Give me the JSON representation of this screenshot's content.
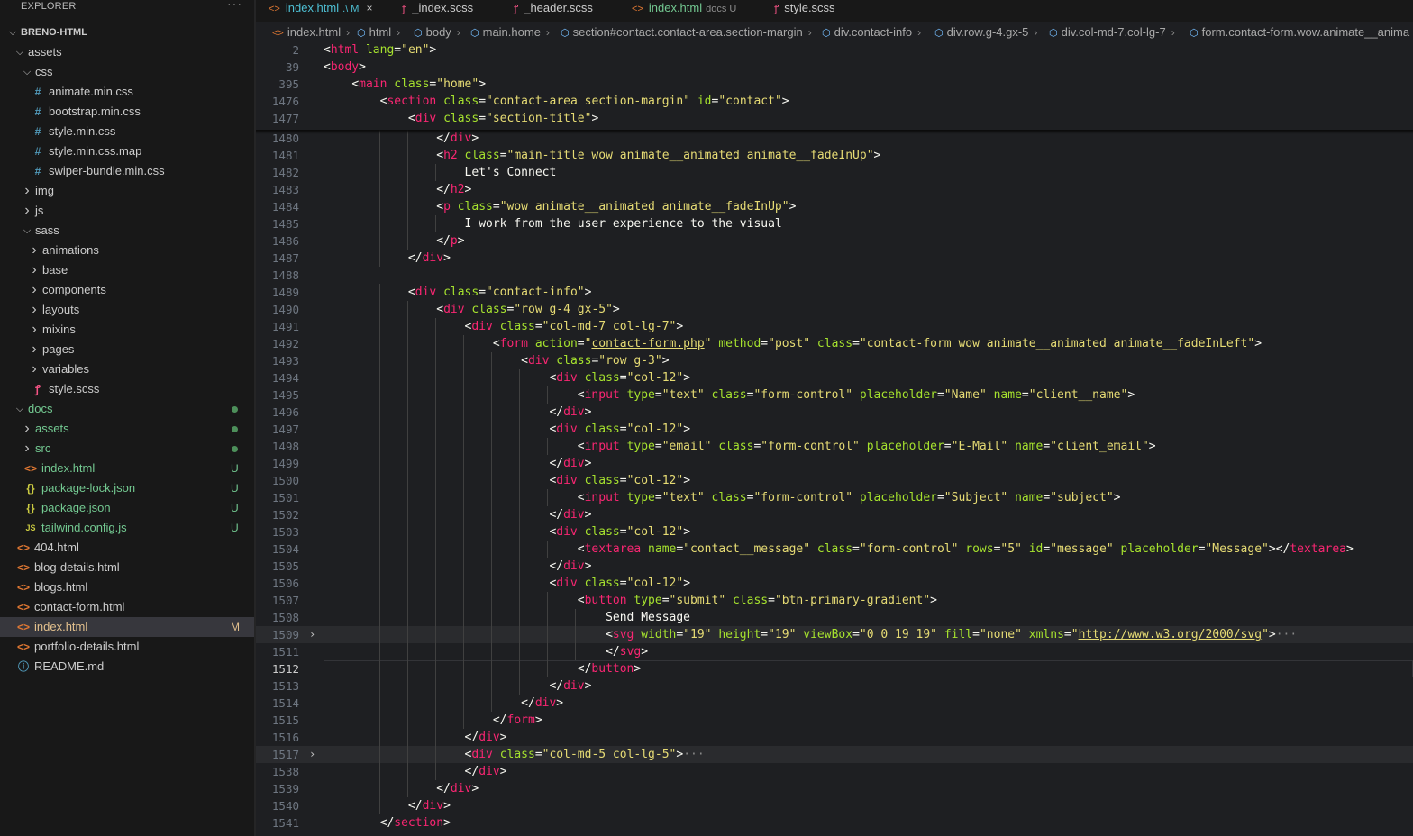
{
  "explorer": {
    "title": "EXPLORER",
    "more": "···"
  },
  "tree": [
    {
      "label": "BRENO-HTML",
      "kind": "root",
      "chev": "v",
      "depth": 0
    },
    {
      "label": "assets",
      "kind": "folder",
      "chev": "v",
      "depth": 1
    },
    {
      "label": "css",
      "kind": "folder",
      "chev": "v",
      "depth": 2
    },
    {
      "label": "animate.min.css",
      "kind": "css",
      "icon": "#",
      "depth": 3
    },
    {
      "label": "bootstrap.min.css",
      "kind": "css",
      "icon": "#",
      "depth": 3
    },
    {
      "label": "style.min.css",
      "kind": "css",
      "icon": "#",
      "depth": 3
    },
    {
      "label": "style.min.css.map",
      "kind": "css",
      "icon": "#",
      "depth": 3
    },
    {
      "label": "swiper-bundle.min.css",
      "kind": "css",
      "icon": "#",
      "depth": 3
    },
    {
      "label": "img",
      "kind": "folder",
      "chev": ">",
      "depth": 2
    },
    {
      "label": "js",
      "kind": "folder",
      "chev": ">",
      "depth": 2
    },
    {
      "label": "sass",
      "kind": "folder",
      "chev": "v",
      "depth": 2
    },
    {
      "label": "animations",
      "kind": "folder",
      "chev": ">",
      "depth": 3
    },
    {
      "label": "base",
      "kind": "folder",
      "chev": ">",
      "depth": 3
    },
    {
      "label": "components",
      "kind": "folder",
      "chev": ">",
      "depth": 3
    },
    {
      "label": "layouts",
      "kind": "folder",
      "chev": ">",
      "depth": 3
    },
    {
      "label": "mixins",
      "kind": "folder",
      "chev": ">",
      "depth": 3
    },
    {
      "label": "pages",
      "kind": "folder",
      "chev": ">",
      "depth": 3
    },
    {
      "label": "variables",
      "kind": "folder",
      "chev": ">",
      "depth": 3
    },
    {
      "label": "style.scss",
      "kind": "scss",
      "icon": "ꝭ",
      "depth": 3
    },
    {
      "label": "docs",
      "kind": "folder",
      "chev": "v",
      "depth": 1,
      "status": "green",
      "dot": true
    },
    {
      "label": "assets",
      "kind": "folder",
      "chev": ">",
      "depth": 2,
      "status": "green",
      "dot": true
    },
    {
      "label": "src",
      "kind": "folder",
      "chev": ">",
      "depth": 2,
      "status": "green",
      "dot": true
    },
    {
      "label": "index.html",
      "kind": "html",
      "icon": "<>",
      "depth": 2,
      "status": "green",
      "badge": "U"
    },
    {
      "label": "package-lock.json",
      "kind": "json",
      "icon": "{}",
      "depth": 2,
      "status": "green",
      "badge": "U"
    },
    {
      "label": "package.json",
      "kind": "json",
      "icon": "{}",
      "depth": 2,
      "status": "green",
      "badge": "U"
    },
    {
      "label": "tailwind.config.js",
      "kind": "js",
      "icon": "JS",
      "depth": 2,
      "status": "green",
      "badge": "U"
    },
    {
      "label": "404.html",
      "kind": "html",
      "icon": "<>",
      "depth": 1
    },
    {
      "label": "blog-details.html",
      "kind": "html",
      "icon": "<>",
      "depth": 1
    },
    {
      "label": "blogs.html",
      "kind": "html",
      "icon": "<>",
      "depth": 1
    },
    {
      "label": "contact-form.html",
      "kind": "html",
      "icon": "<>",
      "depth": 1
    },
    {
      "label": "index.html",
      "kind": "html",
      "icon": "<>",
      "depth": 1,
      "status": "modified",
      "badge": "M",
      "selected": true
    },
    {
      "label": "portfolio-details.html",
      "kind": "html",
      "icon": "<>",
      "depth": 1
    },
    {
      "label": "README.md",
      "kind": "info",
      "icon": "ⓘ",
      "depth": 1
    }
  ],
  "tabs": [
    {
      "label": "index.html",
      "icon": "<>",
      "kind": "html",
      "suffix": ".\\ M",
      "active": true,
      "close": "×"
    },
    {
      "label": "_index.scss",
      "icon": "ꝭ",
      "kind": "scss"
    },
    {
      "label": "_header.scss",
      "icon": "ꝭ",
      "kind": "scss"
    },
    {
      "label": "index.html",
      "icon": "<>",
      "kind": "html",
      "suffix": "docs U",
      "green": true
    },
    {
      "label": "style.scss",
      "icon": "ꝭ",
      "kind": "scss"
    }
  ],
  "breadcrumb": [
    {
      "label": "index.html",
      "icon": "<>"
    },
    {
      "label": "html",
      "icon": "⬡"
    },
    {
      "label": "body",
      "icon": "⬡"
    },
    {
      "label": "main.home",
      "icon": "⬡"
    },
    {
      "label": "section#contact.contact-area.section-margin",
      "icon": "⬡"
    },
    {
      "label": "div.contact-info",
      "icon": "⬡"
    },
    {
      "label": "div.row.g-4.gx-5",
      "icon": "⬡"
    },
    {
      "label": "div.col-md-7.col-lg-7",
      "icon": "⬡"
    },
    {
      "label": "form.contact-form.wow.animate__anima",
      "icon": "⬡"
    }
  ],
  "sticky_lines": [
    {
      "n": "2",
      "text": "<html lang=\"en\">"
    },
    {
      "n": "39",
      "text": "<body>"
    },
    {
      "n": "395",
      "text": "    <main class=\"home\">"
    },
    {
      "n": "1476",
      "text": "        <section class=\"contact-area section-margin\" id=\"contact\">"
    },
    {
      "n": "1477",
      "text": "            <div class=\"section-title\">"
    }
  ],
  "code_lines": [
    {
      "n": "1480",
      "text": "                </div>"
    },
    {
      "n": "1481",
      "text": "                <h2 class=\"main-title wow animate__animated animate__fadeInUp\">"
    },
    {
      "n": "1482",
      "text": "                    Let's Connect"
    },
    {
      "n": "1483",
      "text": "                </h2>"
    },
    {
      "n": "1484",
      "text": "                <p class=\"wow animate__animated animate__fadeInUp\">"
    },
    {
      "n": "1485",
      "text": "                    I work from the user experience to the visual"
    },
    {
      "n": "1486",
      "text": "                </p>"
    },
    {
      "n": "1487",
      "text": "            </div>"
    },
    {
      "n": "1488",
      "text": ""
    },
    {
      "n": "1489",
      "text": "            <div class=\"contact-info\">"
    },
    {
      "n": "1490",
      "text": "                <div class=\"row g-4 gx-5\">"
    },
    {
      "n": "1491",
      "text": "                    <div class=\"col-md-7 col-lg-7\">"
    },
    {
      "n": "1492",
      "text": "                        <form action=\"contact-form.php\" method=\"post\" class=\"contact-form wow animate__animated animate__fadeInLeft\">"
    },
    {
      "n": "1493",
      "text": "                            <div class=\"row g-3\">"
    },
    {
      "n": "1494",
      "text": "                                <div class=\"col-12\">"
    },
    {
      "n": "1495",
      "text": "                                    <input type=\"text\" class=\"form-control\" placeholder=\"Name\" name=\"client__name\">"
    },
    {
      "n": "1496",
      "text": "                                </div>"
    },
    {
      "n": "1497",
      "text": "                                <div class=\"col-12\">"
    },
    {
      "n": "1498",
      "text": "                                    <input type=\"email\" class=\"form-control\" placeholder=\"E-Mail\" name=\"client_email\">"
    },
    {
      "n": "1499",
      "text": "                                </div>"
    },
    {
      "n": "1500",
      "text": "                                <div class=\"col-12\">"
    },
    {
      "n": "1501",
      "text": "                                    <input type=\"text\" class=\"form-control\" placeholder=\"Subject\" name=\"subject\">"
    },
    {
      "n": "1502",
      "text": "                                </div>"
    },
    {
      "n": "1503",
      "text": "                                <div class=\"col-12\">"
    },
    {
      "n": "1504",
      "text": "                                    <textarea name=\"contact__message\" class=\"form-control\" rows=\"5\" id=\"message\" placeholder=\"Message\"></textarea>"
    },
    {
      "n": "1505",
      "text": "                                </div>"
    },
    {
      "n": "1506",
      "text": "                                <div class=\"col-12\">"
    },
    {
      "n": "1507",
      "text": "                                    <button type=\"submit\" class=\"btn-primary-gradient\">"
    },
    {
      "n": "1508",
      "text": "                                        Send Message"
    },
    {
      "n": "1509",
      "text": "                                        <svg width=\"19\" height=\"19\" viewBox=\"0 0 19 19\" fill=\"none\" xmlns=\"http://www.w3.org/2000/svg\">···",
      "fold": true,
      "hl": true
    },
    {
      "n": "1511",
      "text": "                                        </svg>"
    },
    {
      "n": "1512",
      "text": "                                    </button>",
      "current": true
    },
    {
      "n": "1513",
      "text": "                                </div>"
    },
    {
      "n": "1514",
      "text": "                            </div>"
    },
    {
      "n": "1515",
      "text": "                        </form>"
    },
    {
      "n": "1516",
      "text": "                    </div>"
    },
    {
      "n": "1517",
      "text": "                    <div class=\"col-md-5 col-lg-5\">···",
      "fold": true,
      "hl": true
    },
    {
      "n": "1538",
      "text": "                    </div>"
    },
    {
      "n": "1539",
      "text": "                </div>"
    },
    {
      "n": "1540",
      "text": "            </div>"
    },
    {
      "n": "1541",
      "text": "        </section>"
    }
  ]
}
